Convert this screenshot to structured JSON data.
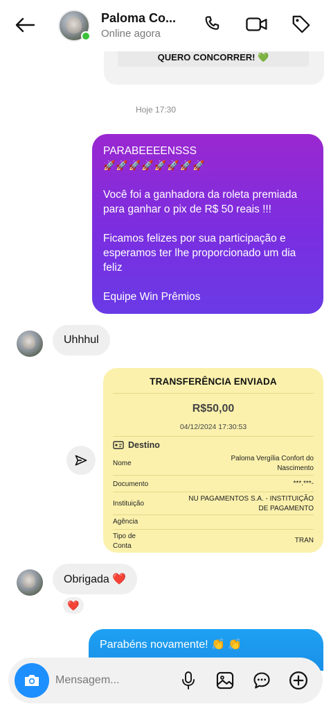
{
  "header": {
    "contact_name": "Paloma Co...",
    "status": "Online agora"
  },
  "previous_message": {
    "button_label": "QUERO CONCORRER! 💚"
  },
  "timestamp": "Hoje 17:30",
  "messages": {
    "congrats": {
      "line1": "PARABEEEENSSS",
      "rockets": "🚀🚀🚀🚀🚀🚀🚀🚀",
      "para2_l1": "Você foi a ganhadora da roleta premiada",
      "para2_l2": "para ganhar o pix de R$ 50 reais !!!",
      "para3_l1": "Ficamos felizes por sua participação e",
      "para3_l2": "esperamos ter lhe proporcionado um dia",
      "para3_l3": "feliz",
      "signature": "Equipe Win Prêmios"
    },
    "reply1": "Uhhhul",
    "reply2": "Obrigada ❤️",
    "reaction": "❤️",
    "blue": "Parabéns novamente! 👏 👏"
  },
  "receipt": {
    "title": "TRANSFERÊNCIA ENVIADA",
    "amount": "R$50,00",
    "datetime": "04/12/2024 17:30:53",
    "destination_label": "Destino",
    "rows": [
      {
        "label": "Nome",
        "value_l1": "Paloma Vergília Confort do",
        "value_l2": "Nascimento"
      },
      {
        "label": "Documento",
        "value_l1": "***.***-",
        "value_l2": ""
      },
      {
        "label": "Instituição",
        "value_l1": "NU PAGAMENTOS S.A. - INSTITUIÇÃO",
        "value_l2": "DE PAGAMENTO"
      },
      {
        "label": "Agência",
        "value_l1": "",
        "value_l2": ""
      },
      {
        "label": "Tipo de",
        "label_l2": "Conta",
        "value_l1": "TRAN",
        "value_l2": ""
      }
    ]
  },
  "composer": {
    "placeholder": "Mensagem..."
  },
  "colors": {
    "purple_bubble": "#7a2ee0",
    "blue_bubble": "#1a8fe8",
    "receipt_bg": "#fbf1ad",
    "online": "#3cc13b",
    "camera": "#1e8fff"
  },
  "icons": [
    "back-arrow-icon",
    "phone-icon",
    "video-icon",
    "tag-icon",
    "send-icon",
    "camera-icon",
    "microphone-icon",
    "gallery-icon",
    "sticker-icon",
    "add-icon",
    "id-card-icon"
  ]
}
